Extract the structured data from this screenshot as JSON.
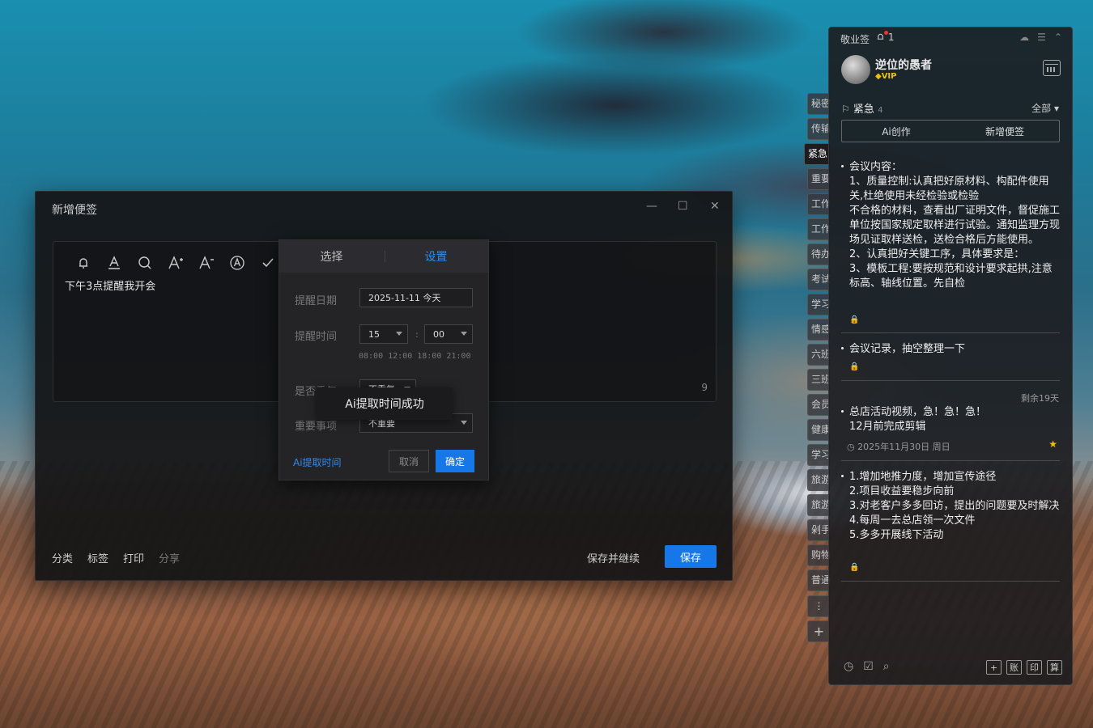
{
  "dialog": {
    "title": "新增便签",
    "minimize": "—",
    "maximize": "☐",
    "close": "✕",
    "note_text": "下午3点提醒我开会",
    "char_count": "9",
    "bottom_links": [
      "分类",
      "标签",
      "打印",
      "分享"
    ],
    "save_continue": "保存并继续",
    "save": "保存"
  },
  "toolbar_icons": [
    "bell-icon",
    "text-color-icon",
    "search-icon",
    "font-increase-icon",
    "font-decrease-icon",
    "text-style-icon",
    "check-icon"
  ],
  "reminder": {
    "tabs": [
      "选择",
      "设置"
    ],
    "date_label": "提醒日期",
    "date_value": "2025-11-11 今天",
    "time_label": "提醒时间",
    "hour": "15",
    "minute": "00",
    "colon": ":",
    "quick_times": "08:00 12:00 18:00 21:00",
    "repeat_label": "是否重复",
    "repeat_value": "不重复",
    "important_label": "重要事项",
    "important_value": "不重要",
    "toast": "Ai提取时间成功",
    "ai_extract": "Ai提取时间",
    "cancel": "取消",
    "ok": "确定"
  },
  "category_tabs": [
    "秘密",
    "传输",
    "紧急",
    "重要",
    "工作",
    "工作",
    "待办",
    "考试",
    "学习",
    "情感",
    "六班",
    "三班",
    "会员",
    "健康",
    "学习",
    "旅游",
    "旅游",
    "剁手",
    "购物",
    "普通"
  ],
  "active_tab": "紧急",
  "sidebar": {
    "app_name": "敬业签",
    "notif_count": "1",
    "username": "逆位的愚者",
    "vip": "◆VIP",
    "category": "紧急",
    "category_count": "4",
    "filter": "全部 ▾",
    "ai_create": "Ai创作",
    "new_note": "新增便签",
    "notes": [
      {
        "text": "会议内容：\n1、质量控制:认真把好原材料、构配件使用关,杜绝使用未经检验或检验\n不合格的材料，查看出厂证明文件，督促施工单位按国家规定取样进行试验。通知监理方现场见证取样送检，送检合格后方能使用。\n2、认真把好关键工序，具体要求是：\n3、模板工程:要按规范和设计要求起拱,注意标高、轴线位置。先自检"
      },
      {
        "text": "会议记录，抽空整理一下"
      },
      {
        "text": "总店活动视频，急！急！急！\n12月前完成剪辑"
      },
      {
        "text": "1.增加地推力度，增加宣传途径\n2.项目收益要稳步向前\n3.对老客户多多回访，提出的问题要及时解决\n4.每周一去总店领一次文件\n5.多多开展线下活动"
      }
    ],
    "remaining": "剩余19天",
    "date_line": "◷ 2025年11月30日 周日",
    "footer_right": [
      "+",
      "账",
      "印",
      "算"
    ]
  }
}
